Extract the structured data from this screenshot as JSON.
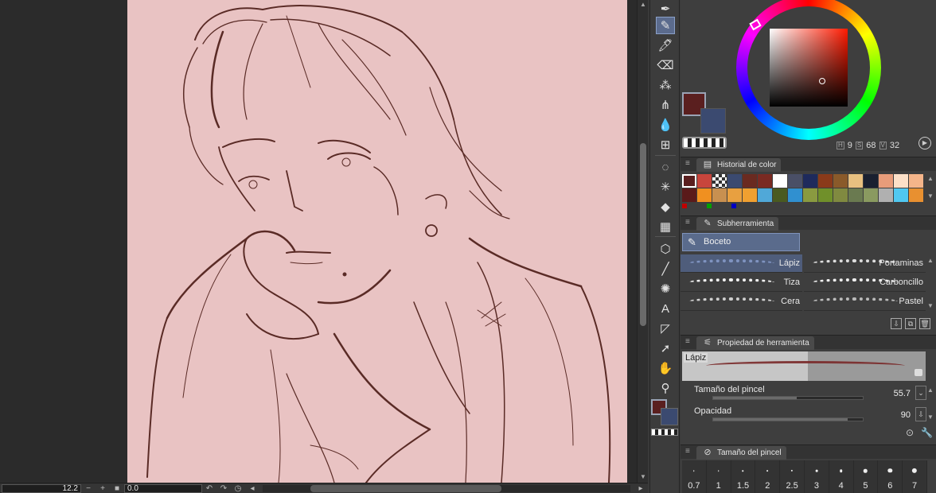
{
  "canvas": {
    "background": "#e9c3c3",
    "line_color": "#5a2b26"
  },
  "status_bar": {
    "zoom": "12.2",
    "rotation": "0.0"
  },
  "tools": [
    {
      "name": "pen-nib-icon",
      "glyph": "✒",
      "active": false
    },
    {
      "name": "pencil-icon",
      "glyph": "✎",
      "active": true
    },
    {
      "name": "marker-icon",
      "glyph": "🖊",
      "active": false
    },
    {
      "name": "eraser-icon",
      "glyph": "⌫",
      "active": false
    },
    {
      "name": "spray-icon",
      "glyph": "⁂",
      "active": false
    },
    {
      "name": "grass-brush-icon",
      "glyph": "⋔",
      "active": false
    },
    {
      "name": "blend-drops-icon",
      "glyph": "💧",
      "active": false
    },
    {
      "name": "grid-figure-icon",
      "glyph": "⊞",
      "active": false
    },
    {
      "name": "lasso-select-icon",
      "glyph": "◌",
      "active": false
    },
    {
      "name": "magic-wand-icon",
      "glyph": "✳",
      "active": false
    },
    {
      "name": "fill-bucket-icon",
      "glyph": "◆",
      "active": false
    },
    {
      "name": "gradient-icon",
      "glyph": "▦",
      "active": false
    },
    {
      "name": "3d-object-icon",
      "glyph": "⬡",
      "active": false
    },
    {
      "name": "line-icon",
      "glyph": "╱",
      "active": false
    },
    {
      "name": "speed-lines-icon",
      "glyph": "✺",
      "active": false
    },
    {
      "name": "text-tool-icon",
      "glyph": "A",
      "active": false
    },
    {
      "name": "frame-border-icon",
      "glyph": "◸",
      "active": false
    },
    {
      "name": "object-select-icon",
      "glyph": "➚",
      "active": false
    },
    {
      "name": "hand-icon",
      "glyph": "✋",
      "active": false
    },
    {
      "name": "eyedropper-icon",
      "glyph": "⚲",
      "active": false
    }
  ],
  "color": {
    "main": "#5a1f1f",
    "sub": "#3b4a70",
    "h_value": "9",
    "s_value": "68",
    "v_value": "32",
    "h_label": "H",
    "s_label": "S",
    "v_label": "V"
  },
  "color_history": {
    "title": "Historial de color",
    "swatches": [
      "#5a1f1f",
      "#c8453c",
      "checker",
      "#3b4a70",
      "#6a2a20",
      "#7a2a22",
      "#ffffff",
      "#4a4f66",
      "#1e2a5c",
      "#8a3a1a",
      "#8a5a2a",
      "#e8c080",
      "#1a2030",
      "#e89c7a",
      "#fce0c8",
      "#f5b58a",
      "",
      "#5a1a1a",
      "#f09020",
      "#c89050",
      "#e8a040",
      "#f0a030",
      "#50a8d8",
      "#4a5a20",
      "#3090d0",
      "#8a9a40",
      "#70902a",
      "#808a40",
      "#6a7a50",
      "#8a9a60",
      "#b0b0b0",
      "#50c8f0",
      "#e89030",
      ""
    ],
    "rgb_dots": [
      "#c00000",
      "#00a000",
      "#0000c0"
    ]
  },
  "sub_tool": {
    "title": "Subherramienta",
    "group": "Boceto",
    "brushes": [
      {
        "label": "Lápiz",
        "selected": true
      },
      {
        "label": "Portaminas",
        "selected": false
      },
      {
        "label": "Tiza",
        "selected": false
      },
      {
        "label": "Carboncillo",
        "selected": false
      },
      {
        "label": "Cera",
        "selected": false
      },
      {
        "label": "Pastel",
        "selected": false
      }
    ]
  },
  "tool_property": {
    "title": "Propiedad de herramienta",
    "preview_label": "Lápiz",
    "brush_size_label": "Tamaño del pincel",
    "brush_size_value": "55.7",
    "brush_size_fraction": 0.557,
    "opacity_label": "Opacidad",
    "opacity_value": "90",
    "opacity_fraction": 0.9
  },
  "brush_size_palette": {
    "title": "Tamaño del pincel",
    "sizes": [
      "0.7",
      "1",
      "1.5",
      "2",
      "2.5",
      "3",
      "4",
      "5",
      "6",
      "7"
    ]
  }
}
